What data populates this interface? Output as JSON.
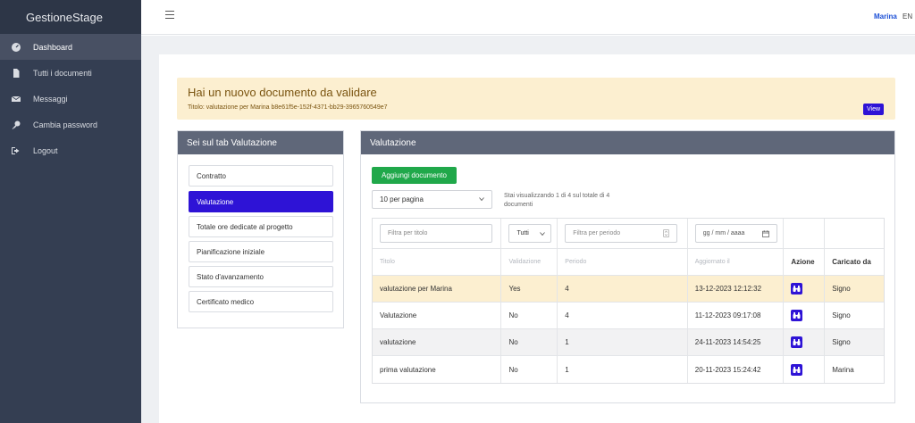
{
  "app": {
    "brand": "GestioneStage"
  },
  "topbar": {
    "user": "Marina",
    "lang": "EN"
  },
  "sidebar": {
    "items": [
      {
        "label": "Dashboard",
        "icon": "dashboard-icon",
        "active": true
      },
      {
        "label": "Tutti i documenti",
        "icon": "file-icon",
        "active": false
      },
      {
        "label": "Messaggi",
        "icon": "envelope-icon",
        "active": false
      },
      {
        "label": "Cambia password",
        "icon": "key-icon",
        "active": false
      },
      {
        "label": "Logout",
        "icon": "logout-icon",
        "active": false
      }
    ]
  },
  "alert": {
    "title": "Hai un nuovo documento da validare",
    "subtitle": "Titolo: valutazione per Marina b8e61f5e-152f-4371-bb29-3965760549e7",
    "button": "View"
  },
  "left_card": {
    "header": "Sei sul tab Valutazione",
    "tabs": [
      {
        "label": "Contratto",
        "active": false
      },
      {
        "label": "Valutazione",
        "active": true
      },
      {
        "label": "Totale ore dedicate al progetto",
        "active": false
      },
      {
        "label": "Pianificazione iniziale",
        "active": false
      },
      {
        "label": "Stato d'avanzamento",
        "active": false
      },
      {
        "label": "Certificato medico",
        "active": false
      }
    ]
  },
  "right_card": {
    "header": "Valutazione",
    "add_button": "Aggiungi documento",
    "per_page": "10 per pagina",
    "showing": "Stai visualizzando 1 di 4 sul totale di 4 documenti",
    "filters": {
      "title_placeholder": "Filtra per titolo",
      "validation_value": "Tutti",
      "period_placeholder": "Filtra per periodo",
      "date_placeholder": "gg / mm / aaaa"
    },
    "columns": [
      "Titolo",
      "Validazione",
      "Periodo",
      "Aggiornato il",
      "Azione",
      "Caricato da"
    ],
    "rows": [
      {
        "titolo": "valutazione per Marina",
        "validazione": "Yes",
        "periodo": "4",
        "aggiornato": "13-12-2023 12:12:32",
        "caricato": "Signo"
      },
      {
        "titolo": "Valutazione",
        "validazione": "No",
        "periodo": "4",
        "aggiornato": "11-12-2023 09:17:08",
        "caricato": "Signo"
      },
      {
        "titolo": "valutazione",
        "validazione": "No",
        "periodo": "1",
        "aggiornato": "24-11-2023 14:54:25",
        "caricato": "Signo"
      },
      {
        "titolo": "prima valutazione",
        "validazione": "No",
        "periodo": "1",
        "aggiornato": "20-11-2023 15:24:42",
        "caricato": "Marina"
      }
    ]
  },
  "colors": {
    "sidebar": "#343e52",
    "accent": "#2e13d6",
    "success": "#20a84a",
    "alert_bg": "#fcefd0",
    "card_header": "#5f6779"
  }
}
